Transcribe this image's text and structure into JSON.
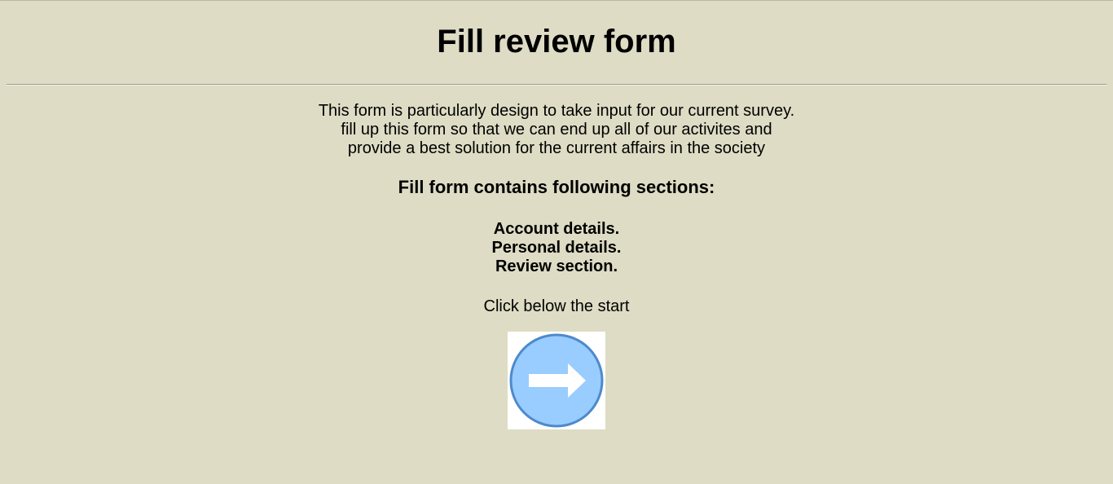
{
  "page": {
    "title": "Fill review form",
    "intro_lines": [
      "This form is particularly design to take input for our current survey.",
      "fill up this form so that we can end up all of our activites and",
      "provide a best solution for the current affairs in the society"
    ],
    "sections_heading": "Fill form contains following sections:",
    "sections": [
      "Account details.",
      "Personal details.",
      "Review section."
    ],
    "start_text": "Click below the start",
    "start_button_icon": "arrow-right-circle-icon"
  },
  "colors": {
    "background": "#dedcc4",
    "button_fill": "#99ccff",
    "button_border": "#4d8acb",
    "arrow": "#ffffff"
  }
}
